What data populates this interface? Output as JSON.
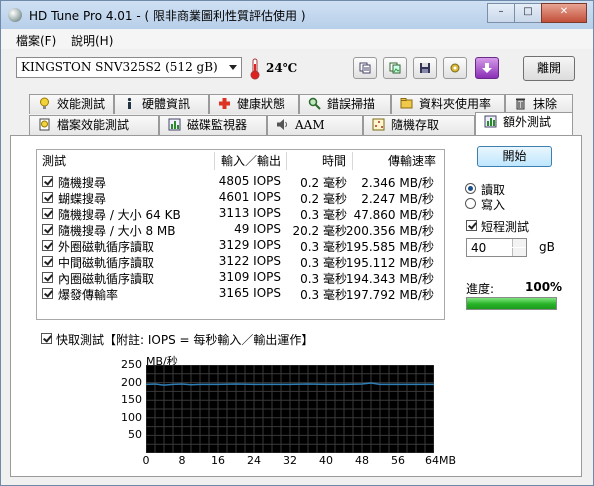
{
  "window": {
    "title": "HD Tune Pro 4.01 - ( 限非商業圖利性質評估使用 )"
  },
  "menu": {
    "file": "檔案(F)",
    "help": "說明(H)"
  },
  "toolbar": {
    "drive": "KINGSTON SNV325S2 (512 gB)",
    "temperature": "24℃",
    "exit_label": "離開"
  },
  "tabs_row1": [
    {
      "label": "效能測試",
      "icon": "benchmark-icon"
    },
    {
      "label": "硬體資訊",
      "icon": "info-icon"
    },
    {
      "label": "健康狀態",
      "icon": "health-icon"
    },
    {
      "label": "錯誤掃描",
      "icon": "error-scan-icon"
    },
    {
      "label": "資料夾使用率",
      "icon": "folder-icon"
    },
    {
      "label": "抹除",
      "icon": "erase-icon"
    }
  ],
  "tabs_row2": [
    {
      "label": "檔案效能測試",
      "icon": "file-benchmark-icon"
    },
    {
      "label": "磁碟監視器",
      "icon": "disk-monitor-icon"
    },
    {
      "label": "AAM",
      "icon": "speaker-icon"
    },
    {
      "label": "隨機存取",
      "icon": "random-access-icon"
    },
    {
      "label": "額外測試",
      "icon": "extra-tests-icon"
    }
  ],
  "results": {
    "headers": {
      "test": "測試",
      "ops": "輸入／輸出",
      "time": "時間",
      "rate": "傳輸速率"
    },
    "rows": [
      {
        "name": "隨機搜尋",
        "ops": "4805 IOPS",
        "time": "0.2 毫秒",
        "rate": "2.346 MB/秒"
      },
      {
        "name": "蝴蝶搜尋",
        "ops": "4601 IOPS",
        "time": "0.2 毫秒",
        "rate": "2.247 MB/秒"
      },
      {
        "name": "隨機搜尋 / 大小 64 KB",
        "ops": "3113 IOPS",
        "time": "0.3 毫秒",
        "rate": "47.860 MB/秒"
      },
      {
        "name": "隨機搜尋 / 大小 8 MB",
        "ops": "49 IOPS",
        "time": "20.2 毫秒",
        "rate": "200.356 MB/秒"
      },
      {
        "name": "外圈磁軌循序讀取",
        "ops": "3129 IOPS",
        "time": "0.3 毫秒",
        "rate": "195.585 MB/秒"
      },
      {
        "name": "中間磁軌循序讀取",
        "ops": "3122 IOPS",
        "time": "0.3 毫秒",
        "rate": "195.112 MB/秒"
      },
      {
        "name": "內圈磁軌循序讀取",
        "ops": "3109 IOPS",
        "time": "0.3 毫秒",
        "rate": "194.343 MB/秒"
      },
      {
        "name": "爆發傳輸率",
        "ops": "3165 IOPS",
        "time": "0.3 毫秒",
        "rate": "197.792 MB/秒"
      }
    ]
  },
  "controls": {
    "start_label": "開始",
    "read_label": "讀取",
    "write_label": "寫入",
    "short_test_label": "短程測試",
    "short_test_value": "40",
    "unit_label": "gB",
    "progress_label": "進度:",
    "progress_value": "100%",
    "progress_fraction": 1.0
  },
  "quick_test_label": "快取測試【附註: IOPS = 每秒輸入／輸出運作】",
  "chart_data": {
    "type": "line",
    "ylabel": "MB/秒",
    "yticks": [
      "250",
      "200",
      "150",
      "100",
      "50"
    ],
    "xticks": [
      "0",
      "8",
      "16",
      "24",
      "32",
      "40",
      "48",
      "56",
      "64MB"
    ],
    "ylim": [
      0,
      250
    ],
    "xlim": [
      0,
      64
    ],
    "series": [
      {
        "values": [
          [
            0,
            195
          ],
          [
            2,
            196
          ],
          [
            4,
            193
          ],
          [
            6,
            195
          ],
          [
            8,
            196
          ],
          [
            10,
            194
          ],
          [
            12,
            195
          ],
          [
            16,
            195
          ],
          [
            20,
            196
          ],
          [
            24,
            195
          ],
          [
            28,
            195
          ],
          [
            32,
            195
          ],
          [
            36,
            196
          ],
          [
            40,
            195
          ],
          [
            44,
            195
          ],
          [
            48,
            196
          ],
          [
            50,
            199
          ],
          [
            52,
            195
          ],
          [
            56,
            195
          ],
          [
            60,
            195
          ],
          [
            64,
            195
          ]
        ]
      }
    ],
    "grid": true,
    "colors": {
      "background": "#000000",
      "grid": "#3a3a3a",
      "line": "#2f7fb7"
    }
  }
}
